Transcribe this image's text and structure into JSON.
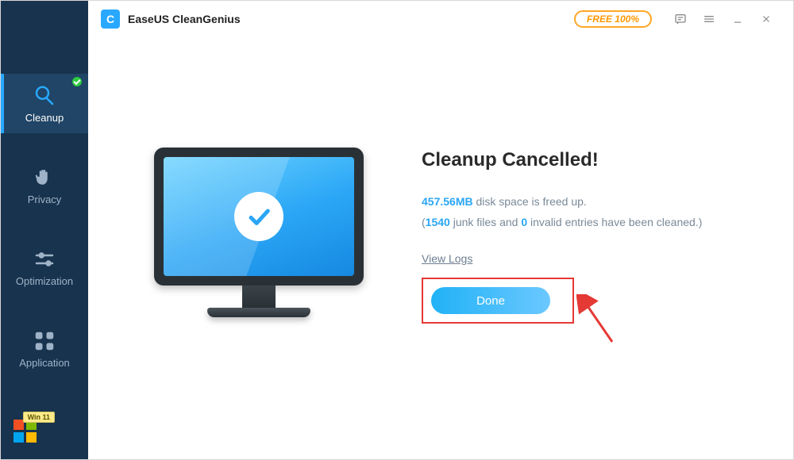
{
  "app": {
    "title": "EaseUS CleanGenius",
    "logo_letter": "C",
    "free_badge": "FREE 100%"
  },
  "sidebar": {
    "items": [
      {
        "label": "Cleanup",
        "icon": "brush-icon",
        "active": true,
        "checked": true
      },
      {
        "label": "Privacy",
        "icon": "hand-icon",
        "active": false,
        "checked": false
      },
      {
        "label": "Optimization",
        "icon": "sliders-icon",
        "active": false,
        "checked": false
      },
      {
        "label": "Application",
        "icon": "apps-icon",
        "active": false,
        "checked": false
      }
    ],
    "win_badge": "Win 11"
  },
  "result": {
    "title": "Cleanup Cancelled!",
    "freed_size": "457.56MB",
    "freed_text_suffix": " disk space is freed up.",
    "junk_count": "1540",
    "junk_text_mid": " junk files and ",
    "invalid_count": "0",
    "invalid_text_suffix": " invalid entries have been cleaned.)",
    "view_logs": "View Logs",
    "done": "Done"
  }
}
